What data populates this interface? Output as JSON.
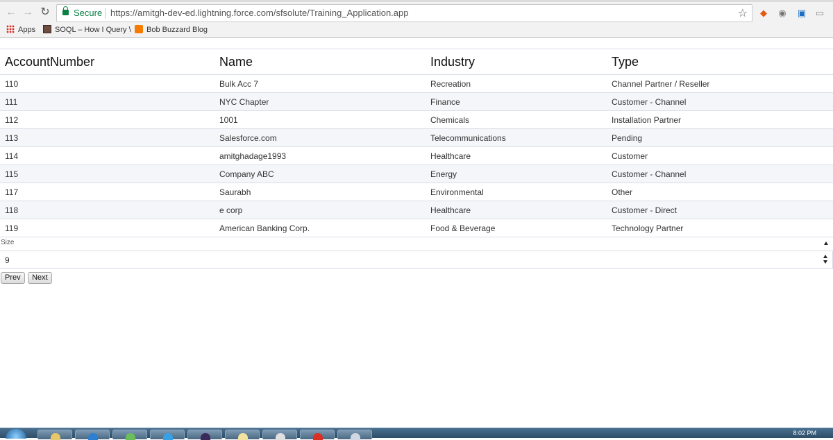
{
  "browser": {
    "secure_label": "Secure",
    "url": "https://amitgh-dev-ed.lightning.force.com/sfsolute/Training_Application.app",
    "bookmarks": [
      {
        "label": "Apps"
      },
      {
        "label": "SOQL – How I Query \\"
      },
      {
        "label": "Bob Buzzard Blog"
      }
    ]
  },
  "table": {
    "headers": [
      "AccountNumber",
      "Name",
      "Industry",
      "Type"
    ],
    "rows": [
      [
        "110",
        "Bulk Acc 7",
        "Recreation",
        "Channel Partner / Reseller"
      ],
      [
        "111",
        "NYC Chapter",
        "Finance",
        "Customer - Channel"
      ],
      [
        "112",
        "1001",
        "Chemicals",
        "Installation Partner"
      ],
      [
        "113",
        "Salesforce.com",
        "Telecommunications",
        "Pending"
      ],
      [
        "114",
        "amitghadage1993",
        "Healthcare",
        "Customer"
      ],
      [
        "115",
        "Company ABC",
        "Energy",
        "Customer - Channel"
      ],
      [
        "117",
        "Saurabh",
        "Environmental",
        "Other"
      ],
      [
        "118",
        "e corp",
        "Healthcare",
        "Customer - Direct"
      ],
      [
        "119",
        "American Banking Corp.",
        "Food & Beverage",
        "Technology Partner"
      ]
    ]
  },
  "size": {
    "label": "Size",
    "value": "9"
  },
  "pager": {
    "prev_label": "Prev",
    "next_label": "Next"
  },
  "taskbar": {
    "clock": "8:02 PM"
  }
}
